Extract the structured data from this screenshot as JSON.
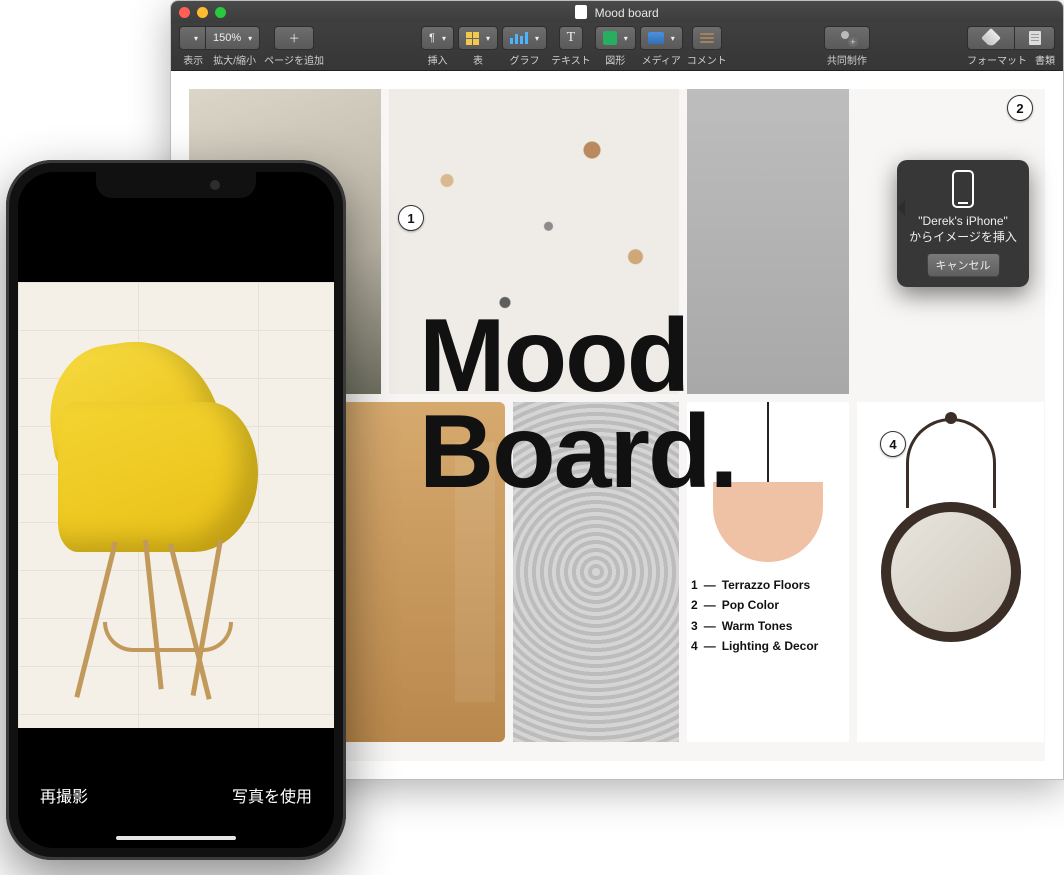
{
  "window": {
    "title": "Mood board",
    "traffic": [
      "close",
      "minimize",
      "zoom"
    ]
  },
  "toolbar": {
    "view": "表示",
    "zoom_value": "150%",
    "zoom_label": "拡大/縮小",
    "add_page_icon": "＋",
    "add_page": "ページを追加",
    "insert": "挿入",
    "table": "表",
    "chart": "グラフ",
    "text": "テキスト",
    "text_btn": "T",
    "shape": "図形",
    "media": "メディア",
    "comment": "コメント",
    "collaborate": "共同制作",
    "format": "フォーマット",
    "document": "書類"
  },
  "board": {
    "title_line1": "Mood",
    "title_line2": "Board.",
    "badges": {
      "b1": "1",
      "b2": "2",
      "b4": "4"
    },
    "legend": [
      {
        "n": "1",
        "label": "Terrazzo Floors"
      },
      {
        "n": "2",
        "label": "Pop Color"
      },
      {
        "n": "3",
        "label": "Warm Tones"
      },
      {
        "n": "4",
        "label": "Lighting & Decor"
      }
    ]
  },
  "popover": {
    "line1": "\"Derek's iPhone\"",
    "line2": "からイメージを挿入",
    "cancel": "キャンセル"
  },
  "iphone": {
    "retake": "再撮影",
    "use_photo": "写真を使用"
  }
}
